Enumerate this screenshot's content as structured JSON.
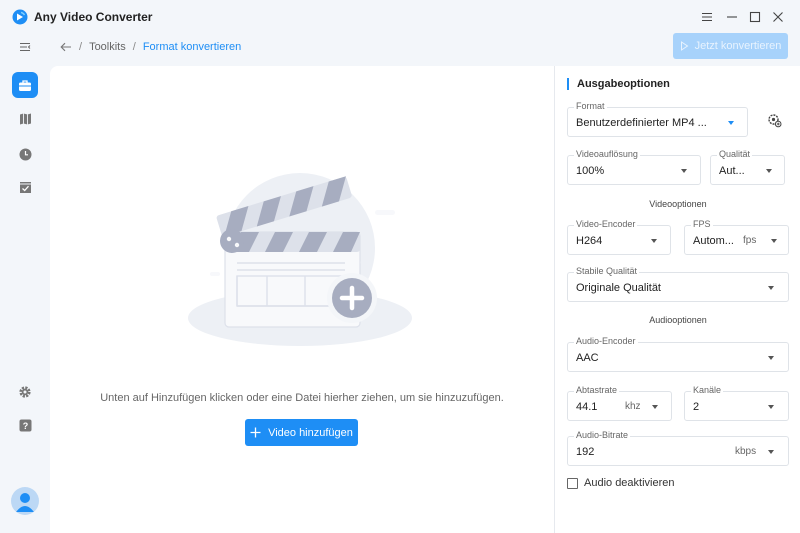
{
  "app": {
    "title": "Any Video Converter"
  },
  "window_controls": [
    "menu-icon",
    "minimize-icon",
    "maximize-icon",
    "close-icon"
  ],
  "sidebar": {
    "items": [
      {
        "icon": "collapse-menu-icon"
      },
      {
        "icon": "toolbox-icon",
        "active": true
      },
      {
        "icon": "book-icon"
      },
      {
        "icon": "history-icon"
      },
      {
        "icon": "task-check-icon"
      },
      {
        "icon": "gear-icon"
      },
      {
        "icon": "help-icon"
      },
      {
        "icon": "avatar-icon"
      }
    ]
  },
  "breadcrumb": {
    "root": "Toolkits",
    "current": "Format konvertieren",
    "separator": "/"
  },
  "toolbar": {
    "convert_label": "Jetzt konvertieren"
  },
  "main": {
    "drop_hint": "Unten auf Hinzufügen klicken oder eine Datei hierher ziehen, um sie hinzuzufügen.",
    "add_label": "Video hinzufügen"
  },
  "output": {
    "title": "Ausgabeoptionen",
    "format": {
      "label": "Format",
      "value": "Benutzerdefinierter MP4 ..."
    },
    "resolution": {
      "label": "Videoauflösung",
      "value": "100%"
    },
    "quality": {
      "label": "Qualität",
      "value": "Aut..."
    },
    "video_section": "Videooptionen",
    "video_encoder": {
      "label": "Video-Encoder",
      "value": "H264"
    },
    "fps": {
      "label": "FPS",
      "value": "Autom...",
      "unit": "fps"
    },
    "stable_quality": {
      "label": "Stabile Qualität",
      "value": "Originale Qualität"
    },
    "audio_section": "Audiooptionen",
    "audio_encoder": {
      "label": "Audio-Encoder",
      "value": "AAC"
    },
    "sample_rate": {
      "label": "Abtastrate",
      "value": "44.1",
      "unit": "khz"
    },
    "channels": {
      "label": "Kanäle",
      "value": "2"
    },
    "bitrate": {
      "label": "Audio-Bitrate",
      "value": "192",
      "unit": "kbps"
    },
    "disable_audio": {
      "label": "Audio deaktivieren",
      "checked": false
    }
  },
  "colors": {
    "accent": "#1e8ef5",
    "accent_disabled": "#a7d2fb",
    "background": "#f3f6fa"
  }
}
